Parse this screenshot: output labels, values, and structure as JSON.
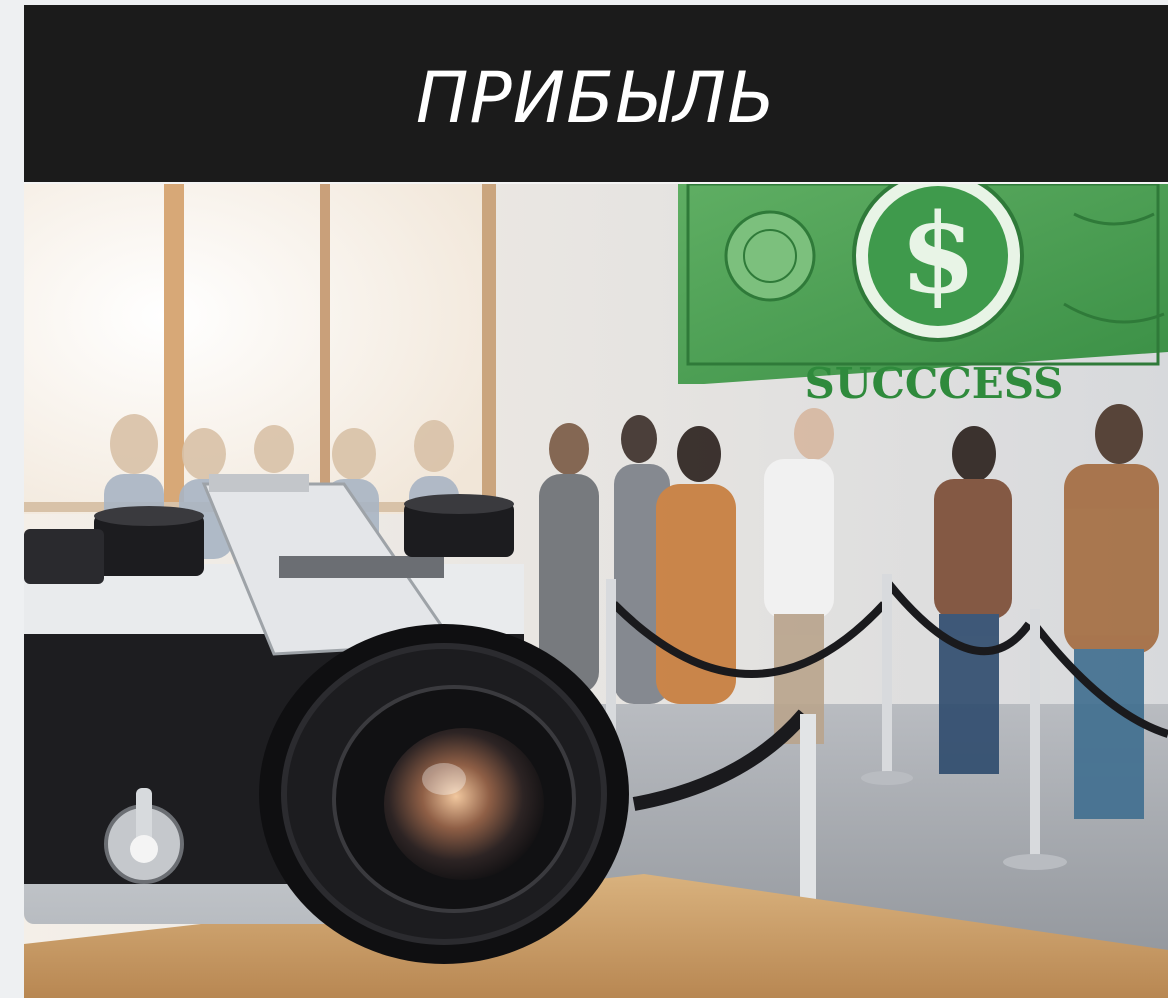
{
  "header": {
    "title": "ПРИБЫЛЬ"
  },
  "hero": {
    "banner_word": "SUCCCESS",
    "currency_symbol": "$",
    "colors": {
      "title_bar": "#1b1b1b",
      "title_text": "#ffffff",
      "bill_green": "#3f9a4c",
      "banner_text": "#2f8a3c"
    }
  }
}
